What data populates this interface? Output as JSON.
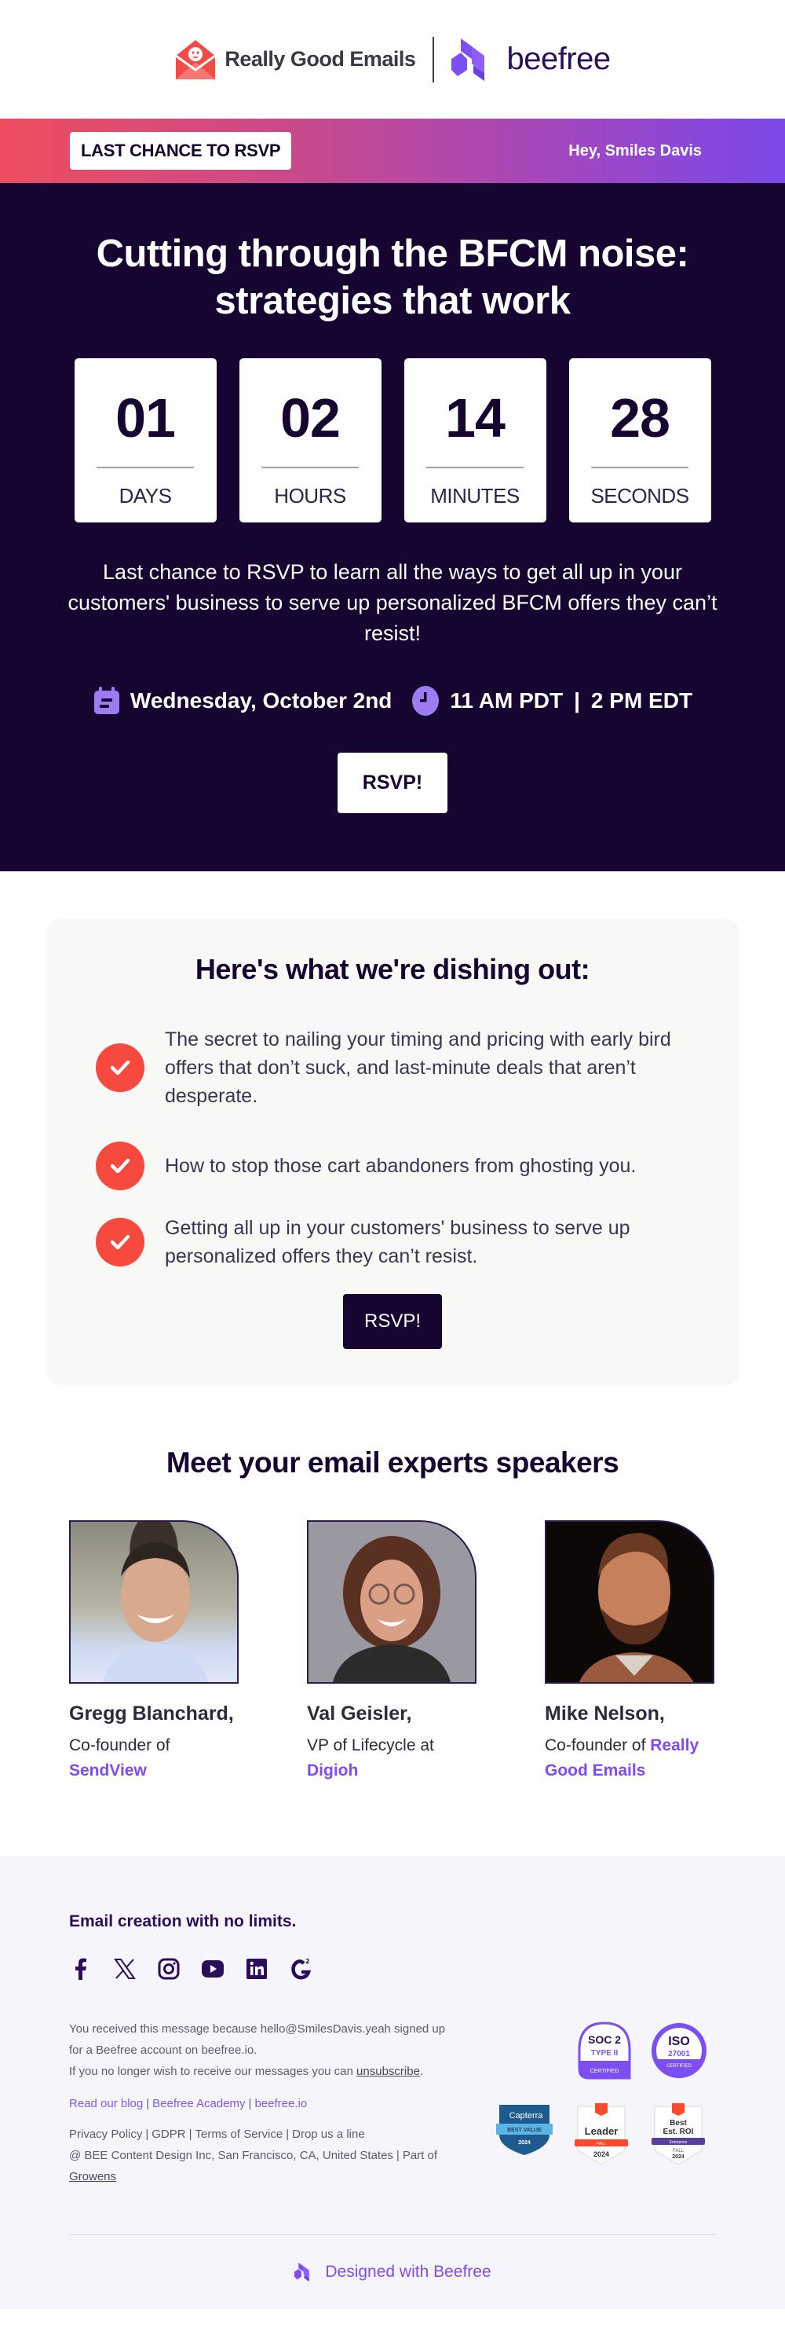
{
  "header": {
    "brand_left": "Really Good Emails",
    "brand_right": "beefree"
  },
  "banner": {
    "badge": "LAST CHANCE TO RSVP",
    "greeting": "Hey, Smiles Davis",
    "gradient_start": "#ee4d5e",
    "gradient_end": "#7b49e8"
  },
  "hero": {
    "title_line1": "Cutting through the BFCM noise:",
    "title_line2": "strategies that work",
    "countdown": [
      {
        "value": "01",
        "label": "DAYS"
      },
      {
        "value": "02",
        "label": "HOURS"
      },
      {
        "value": "14",
        "label": "MINUTES"
      },
      {
        "value": "28",
        "label": "SECONDS"
      }
    ],
    "copy": "Last chance to RSVP to learn all the ways to get all up in your customers' business to serve up personalized BFCM offers they can’t resist!",
    "date": "Wednesday, October 2nd",
    "time_pdt": "11 AM PDT",
    "time_sep": "|",
    "time_edt": "2 PM EDT",
    "cta": "RSVP!",
    "background": "#150530",
    "icon_color": "#9c7cf0"
  },
  "agenda": {
    "title": "Here's what we're dishing out:",
    "points": [
      "The secret to nailing your timing and pricing with early bird offers that don’t suck, and last-minute deals that aren’t desperate.",
      "How to stop those cart abandoners from ghosting you.",
      "Getting all up in your customers' business to serve up personalized offers they can’t resist."
    ],
    "cta": "RSVP!",
    "check_color": "#f8493e"
  },
  "speakers": {
    "title": "Meet your email experts speakers",
    "items": [
      {
        "name": "Gregg Blanchard,",
        "role": "Co-founder of",
        "org": "SendView"
      },
      {
        "name": "Val Geisler,",
        "role": "VP of Lifecycle at",
        "org": "Digioh"
      },
      {
        "name": "Mike Nelson,",
        "role": "Co-founder of",
        "org": "Really Good Emails"
      }
    ]
  },
  "footer": {
    "tagline": "Email creation with no limits.",
    "socials": [
      "facebook",
      "x",
      "instagram",
      "youtube",
      "linkedin",
      "g2"
    ],
    "received": "You received this message because hello@SmilesDavis.yeah  signed up for a Beefree account on beefree.io.",
    "unsub_prefix": "If you no longer wish to receive our messages you can",
    "unsub_link": "unsubscribe",
    "unsub_suffix": ".",
    "links": [
      "Read our blog",
      "Beefree Academy",
      "beefree.io"
    ],
    "policy_links": [
      "Privacy Policy",
      "GDPR",
      "Terms of Service",
      "Drop us a line"
    ],
    "address": "@ BEE Content Design Inc, San Francisco, CA, United States",
    "part_of": "Part of",
    "parent": "Growens",
    "badges": {
      "soc2_line1": "SOC 2",
      "soc2_line2": "TYPE II",
      "soc2_foot": "CERTIFIED",
      "iso_line1": "ISO",
      "iso_line2": "27001",
      "iso_foot": "CERTIFIED",
      "capterra_brand": "Capterra",
      "capterra_title": "BEST VALUE",
      "capterra_year": "2024",
      "g2_leader_title": "Leader",
      "g2_leader_ribbon": "FALL",
      "g2_leader_year": "2024",
      "g2_roi_line1": "Best",
      "g2_roi_line2": "Est. ROI",
      "g2_roi_ribbon": "Enterprise",
      "g2_roi_season": "FALL",
      "g2_roi_year": "2024"
    },
    "designed_with": "Designed with Beefree"
  }
}
